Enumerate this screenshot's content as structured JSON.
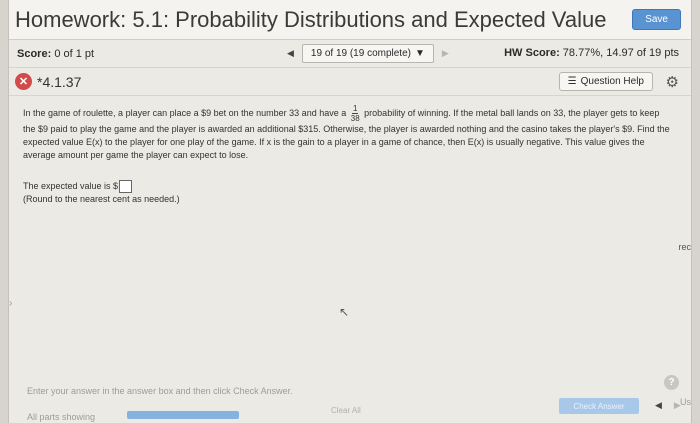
{
  "header": {
    "title": "Homework: 5.1: Probability Distributions and Expected Value",
    "save_label": "Save"
  },
  "scorebar": {
    "score_label": "Score:",
    "score_value": "0 of 1 pt",
    "question_counter": "19 of 19 (19 complete)",
    "hw_score_label": "HW Score:",
    "hw_score_value": "78.77%, 14.97 of 19 pts"
  },
  "question": {
    "number": "*4.1.37",
    "help_label": "Question Help",
    "text_before_fraction": "In the game of roulette, a player can place a $9 bet on the number 33 and have a",
    "fraction_numerator": "1",
    "fraction_denominator": "38",
    "text_after_fraction": "probability of winning. If the metal ball lands on 33, the player gets to keep the",
    "text_rest": "$9 paid to play the game and the player is awarded an additional $315. Otherwise, the player is awarded nothing and the casino takes the player's $9. Find the expected value E(x) to the player for one play of the game. If x is the gain to a player in a game of chance, then E(x) is usually negative. This value gives the average amount per game the player can expect to lose.",
    "answer_prompt": "The expected value is $",
    "answer_value": "",
    "answer_note": "(Round to the nearest cent as needed.)"
  },
  "side_text": "rec",
  "footer": {
    "hint": "Enter your answer in the answer box and then click Check Answer.",
    "parts_label": "All parts showing",
    "progress_fraction": 1.0,
    "clear_all_label": "Clear All",
    "check_answer_label": "Check Answer",
    "edge_label": "Us"
  },
  "colors": {
    "save_button": "#5a93d2",
    "incorrect_icon": "#d24a4a",
    "check_button": "#a8c8ea"
  }
}
